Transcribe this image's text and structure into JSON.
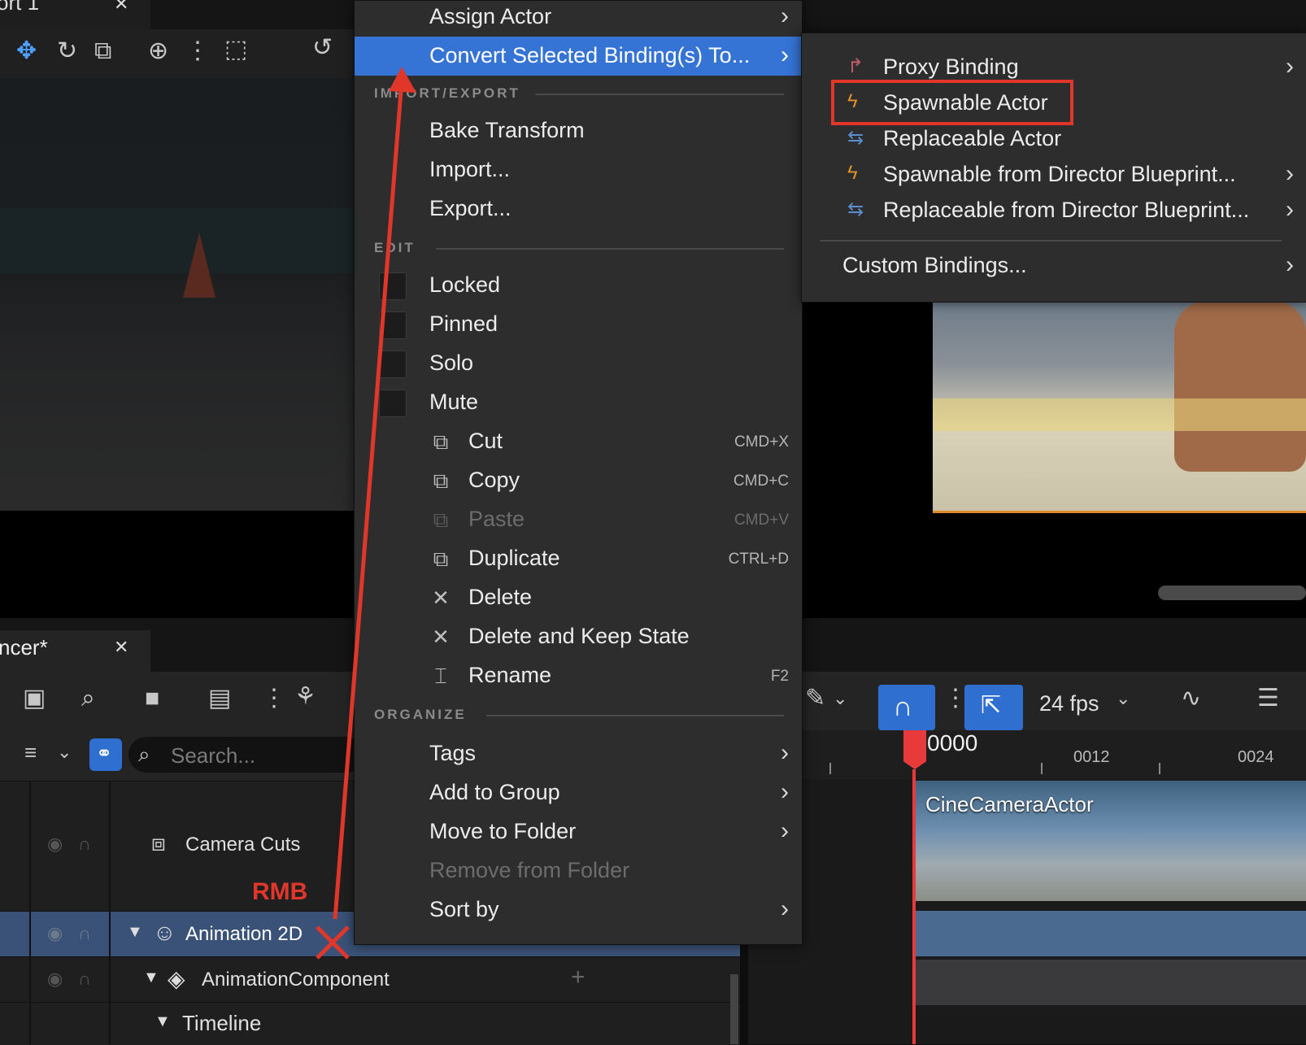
{
  "viewport": {
    "tab_label": "ort 1",
    "tab_close": "✕"
  },
  "sequencer": {
    "tab_label": "ncer*",
    "tab_close": "✕",
    "search_placeholder": "Search...",
    "fps_label": "24 fps",
    "tracks": [
      {
        "label": "Camera Cuts"
      },
      {
        "label": "Animation 2D"
      },
      {
        "label": "AnimationComponent"
      },
      {
        "label": "Timeline"
      }
    ],
    "timeline": {
      "current_frame": "0000",
      "ticks": [
        "0012",
        "0024"
      ],
      "clip_label": "CineCameraActor"
    }
  },
  "annotation": {
    "rmb_label": "RMB",
    "arrow_color": "#e0372a"
  },
  "context_menu": {
    "top_items": [
      {
        "label": "Assign Actor",
        "has_submenu": true
      },
      {
        "label": "Convert Selected Binding(s) To...",
        "has_submenu": true,
        "highlighted": true
      }
    ],
    "sections": {
      "import_export": "IMPORT/EXPORT",
      "edit": "EDIT",
      "organize": "ORGANIZE"
    },
    "import_export_items": [
      {
        "label": "Bake Transform"
      },
      {
        "label": "Import..."
      },
      {
        "label": "Export..."
      }
    ],
    "checkbox_items": [
      {
        "label": "Locked"
      },
      {
        "label": "Pinned"
      },
      {
        "label": "Solo"
      },
      {
        "label": "Mute"
      }
    ],
    "edit_items": [
      {
        "label": "Cut",
        "shortcut": "CMD+X",
        "icon": "cut-icon"
      },
      {
        "label": "Copy",
        "shortcut": "CMD+C",
        "icon": "copy-icon"
      },
      {
        "label": "Paste",
        "shortcut": "CMD+V",
        "icon": "paste-icon",
        "disabled": true
      },
      {
        "label": "Duplicate",
        "shortcut": "CTRL+D",
        "icon": "duplicate-icon"
      },
      {
        "label": "Delete",
        "shortcut": "",
        "icon": "delete-icon"
      },
      {
        "label": "Delete and Keep State",
        "shortcut": "",
        "icon": "delete-icon"
      },
      {
        "label": "Rename",
        "shortcut": "F2",
        "icon": "rename-icon"
      }
    ],
    "organize_items": [
      {
        "label": "Tags",
        "has_submenu": true
      },
      {
        "label": "Add to Group",
        "has_submenu": true
      },
      {
        "label": "Move to Folder",
        "has_submenu": true
      },
      {
        "label": "Remove from Folder",
        "disabled": true
      },
      {
        "label": "Sort by",
        "has_submenu": true
      }
    ]
  },
  "submenu": {
    "items": [
      {
        "label": "Proxy Binding",
        "has_submenu": true,
        "icon": "proxy-icon",
        "icon_color": "#c05a6a"
      },
      {
        "label": "Spawnable Actor",
        "has_submenu": false,
        "icon": "lightning-icon",
        "icon_color": "#e0902a"
      },
      {
        "label": "Replaceable Actor",
        "has_submenu": false,
        "icon": "swap-icon",
        "icon_color": "#5a8ed0"
      },
      {
        "label": "Spawnable from Director Blueprint...",
        "has_submenu": true,
        "icon": "lightning-icon",
        "icon_color": "#e0902a"
      },
      {
        "label": "Replaceable from Director Blueprint...",
        "has_submenu": true,
        "icon": "swap-icon",
        "icon_color": "#5a8ed0"
      }
    ],
    "custom": {
      "label": "Custom Bindings...",
      "has_submenu": true
    },
    "highlight_color": "#e0372a"
  }
}
